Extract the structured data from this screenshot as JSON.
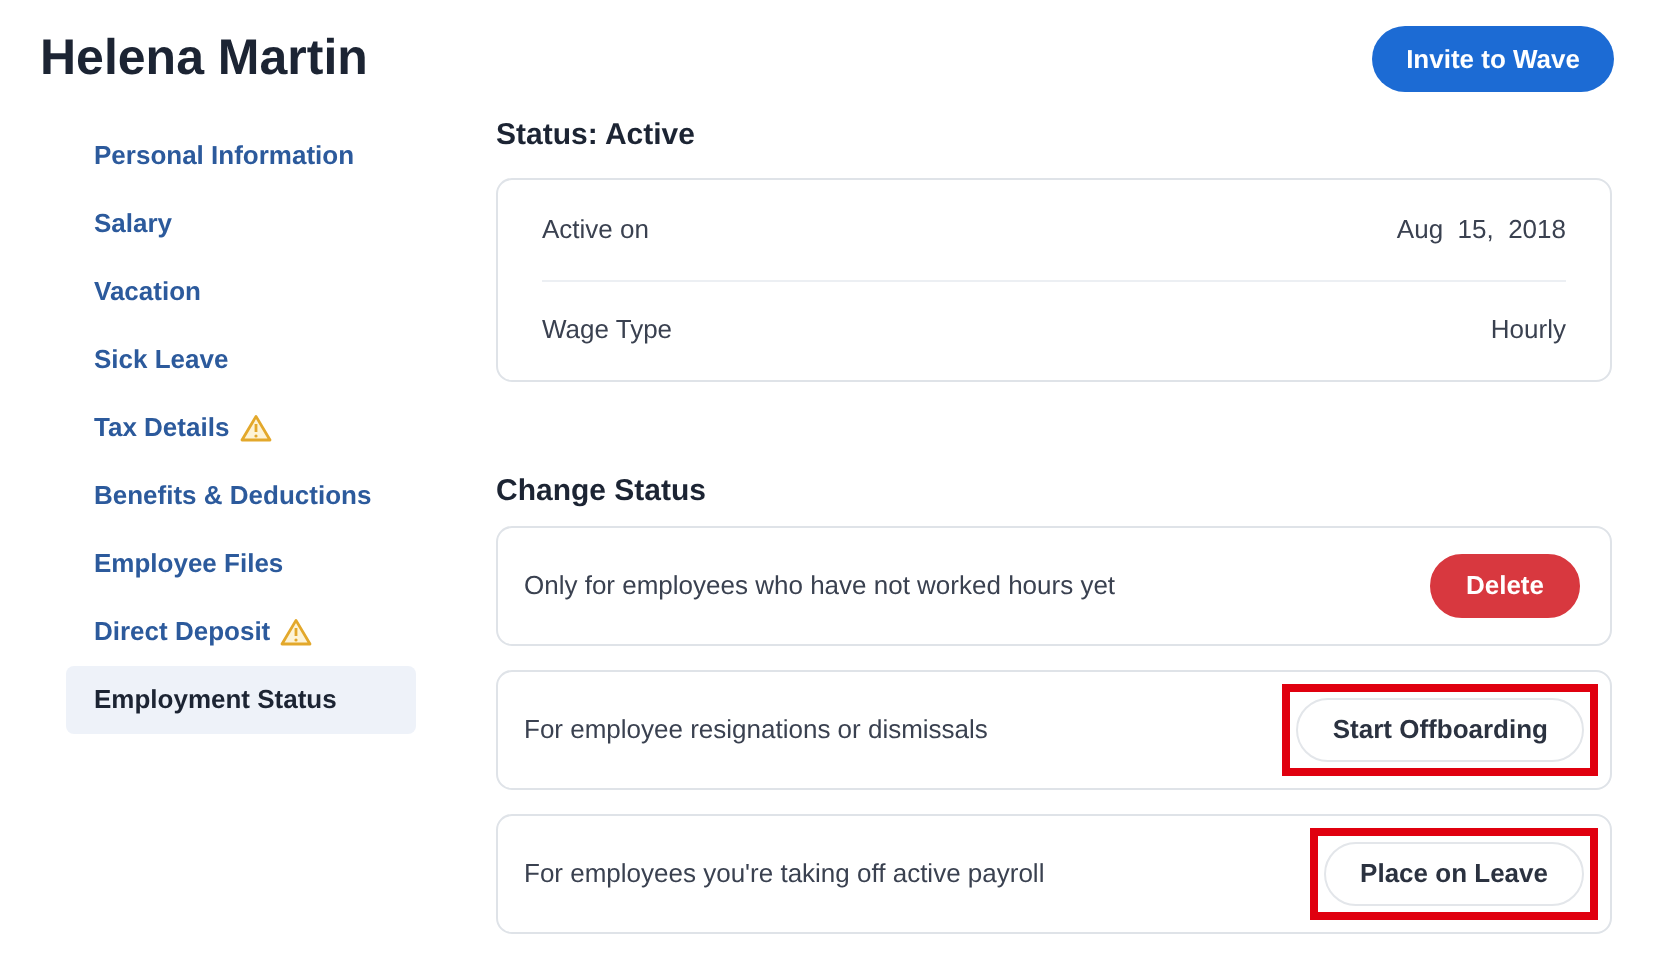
{
  "header": {
    "title": "Helena Martin",
    "action": "Invite to Wave"
  },
  "sidebar": {
    "items": [
      {
        "label": "Personal Information",
        "selected": false,
        "warning": false
      },
      {
        "label": "Salary",
        "selected": false,
        "warning": false
      },
      {
        "label": "Vacation",
        "selected": false,
        "warning": false
      },
      {
        "label": "Sick Leave",
        "selected": false,
        "warning": false
      },
      {
        "label": "Tax Details",
        "selected": false,
        "warning": true
      },
      {
        "label": "Benefits & Deductions",
        "selected": false,
        "warning": false
      },
      {
        "label": "Employee Files",
        "selected": false,
        "warning": false
      },
      {
        "label": "Direct Deposit",
        "selected": false,
        "warning": true
      },
      {
        "label": "Employment Status",
        "selected": true,
        "warning": false
      }
    ]
  },
  "status": {
    "heading": "Status: Active",
    "rows": [
      {
        "label": "Active on",
        "value": "Aug  15,  2018"
      },
      {
        "label": "Wage Type",
        "value": "Hourly"
      }
    ]
  },
  "change_status": {
    "heading": "Change Status",
    "options": [
      {
        "description": "Only for employees who have not worked hours yet",
        "button": "Delete",
        "kind": "danger",
        "highlighted": false
      },
      {
        "description": "For employee resignations or dismissals",
        "button": "Start Offboarding",
        "kind": "outline",
        "highlighted": true
      },
      {
        "description": "For employees you're taking off active payroll",
        "button": "Place on Leave",
        "kind": "outline",
        "highlighted": true
      }
    ]
  }
}
